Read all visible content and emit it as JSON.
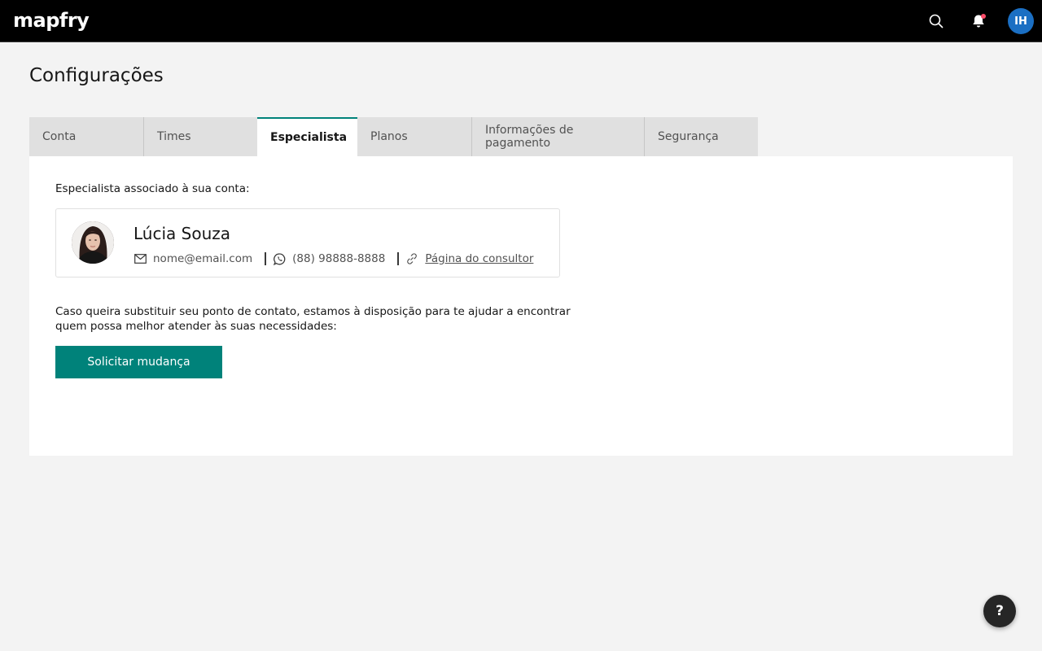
{
  "header": {
    "logo": "mapfry",
    "user_initials": "IH"
  },
  "page": {
    "title": "Configurações"
  },
  "tabs": [
    {
      "label": "Conta",
      "active": false
    },
    {
      "label": "Times",
      "active": false
    },
    {
      "label": "Especialista",
      "active": true
    },
    {
      "label": "Planos",
      "active": false
    },
    {
      "label": "Informações de pagamento",
      "active": false
    },
    {
      "label": "Segurança",
      "active": false
    }
  ],
  "specialist": {
    "section_label": "Especialista associado à sua conta:",
    "name": "Lúcia Souza",
    "email": "nome@email.com",
    "phone": "(88) 98888-8888",
    "page_link": "Página do consultor"
  },
  "change_request": {
    "description": "Caso queira substituir seu ponto de contato, estamos à disposição para te ajudar a encontrar quem possa melhor atender às suas necessidades:",
    "button_label": "Solicitar mudança"
  },
  "help": {
    "label": "?"
  },
  "colors": {
    "accent": "#00827a",
    "topbar": "#000000",
    "avatar": "#1b6fc3",
    "notification_dot": "#ff4d6a"
  },
  "icons": [
    "search-icon",
    "bell-icon",
    "mail-icon",
    "whatsapp-icon",
    "link-icon"
  ]
}
